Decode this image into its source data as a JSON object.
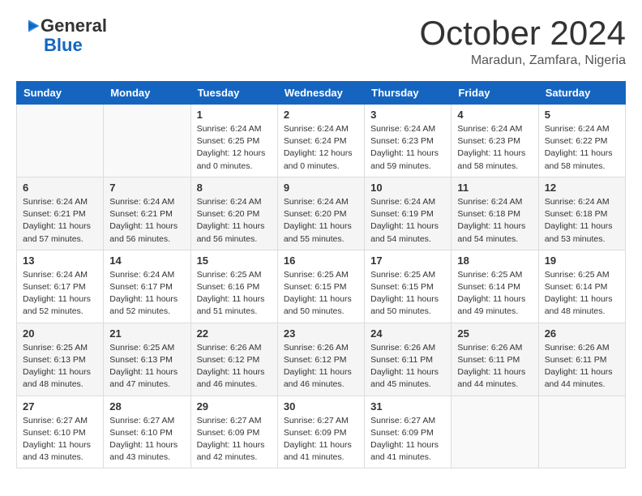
{
  "logo": {
    "line1": "General",
    "line2": "Blue"
  },
  "title": "October 2024",
  "subtitle": "Maradun, Zamfara, Nigeria",
  "days_of_week": [
    "Sunday",
    "Monday",
    "Tuesday",
    "Wednesday",
    "Thursday",
    "Friday",
    "Saturday"
  ],
  "weeks": [
    [
      {
        "day": "",
        "info": ""
      },
      {
        "day": "",
        "info": ""
      },
      {
        "day": "1",
        "info": "Sunrise: 6:24 AM\nSunset: 6:25 PM\nDaylight: 12 hours and 0 minutes."
      },
      {
        "day": "2",
        "info": "Sunrise: 6:24 AM\nSunset: 6:24 PM\nDaylight: 12 hours and 0 minutes."
      },
      {
        "day": "3",
        "info": "Sunrise: 6:24 AM\nSunset: 6:23 PM\nDaylight: 11 hours and 59 minutes."
      },
      {
        "day": "4",
        "info": "Sunrise: 6:24 AM\nSunset: 6:23 PM\nDaylight: 11 hours and 58 minutes."
      },
      {
        "day": "5",
        "info": "Sunrise: 6:24 AM\nSunset: 6:22 PM\nDaylight: 11 hours and 58 minutes."
      }
    ],
    [
      {
        "day": "6",
        "info": "Sunrise: 6:24 AM\nSunset: 6:21 PM\nDaylight: 11 hours and 57 minutes."
      },
      {
        "day": "7",
        "info": "Sunrise: 6:24 AM\nSunset: 6:21 PM\nDaylight: 11 hours and 56 minutes."
      },
      {
        "day": "8",
        "info": "Sunrise: 6:24 AM\nSunset: 6:20 PM\nDaylight: 11 hours and 56 minutes."
      },
      {
        "day": "9",
        "info": "Sunrise: 6:24 AM\nSunset: 6:20 PM\nDaylight: 11 hours and 55 minutes."
      },
      {
        "day": "10",
        "info": "Sunrise: 6:24 AM\nSunset: 6:19 PM\nDaylight: 11 hours and 54 minutes."
      },
      {
        "day": "11",
        "info": "Sunrise: 6:24 AM\nSunset: 6:18 PM\nDaylight: 11 hours and 54 minutes."
      },
      {
        "day": "12",
        "info": "Sunrise: 6:24 AM\nSunset: 6:18 PM\nDaylight: 11 hours and 53 minutes."
      }
    ],
    [
      {
        "day": "13",
        "info": "Sunrise: 6:24 AM\nSunset: 6:17 PM\nDaylight: 11 hours and 52 minutes."
      },
      {
        "day": "14",
        "info": "Sunrise: 6:24 AM\nSunset: 6:17 PM\nDaylight: 11 hours and 52 minutes."
      },
      {
        "day": "15",
        "info": "Sunrise: 6:25 AM\nSunset: 6:16 PM\nDaylight: 11 hours and 51 minutes."
      },
      {
        "day": "16",
        "info": "Sunrise: 6:25 AM\nSunset: 6:15 PM\nDaylight: 11 hours and 50 minutes."
      },
      {
        "day": "17",
        "info": "Sunrise: 6:25 AM\nSunset: 6:15 PM\nDaylight: 11 hours and 50 minutes."
      },
      {
        "day": "18",
        "info": "Sunrise: 6:25 AM\nSunset: 6:14 PM\nDaylight: 11 hours and 49 minutes."
      },
      {
        "day": "19",
        "info": "Sunrise: 6:25 AM\nSunset: 6:14 PM\nDaylight: 11 hours and 48 minutes."
      }
    ],
    [
      {
        "day": "20",
        "info": "Sunrise: 6:25 AM\nSunset: 6:13 PM\nDaylight: 11 hours and 48 minutes."
      },
      {
        "day": "21",
        "info": "Sunrise: 6:25 AM\nSunset: 6:13 PM\nDaylight: 11 hours and 47 minutes."
      },
      {
        "day": "22",
        "info": "Sunrise: 6:26 AM\nSunset: 6:12 PM\nDaylight: 11 hours and 46 minutes."
      },
      {
        "day": "23",
        "info": "Sunrise: 6:26 AM\nSunset: 6:12 PM\nDaylight: 11 hours and 46 minutes."
      },
      {
        "day": "24",
        "info": "Sunrise: 6:26 AM\nSunset: 6:11 PM\nDaylight: 11 hours and 45 minutes."
      },
      {
        "day": "25",
        "info": "Sunrise: 6:26 AM\nSunset: 6:11 PM\nDaylight: 11 hours and 44 minutes."
      },
      {
        "day": "26",
        "info": "Sunrise: 6:26 AM\nSunset: 6:11 PM\nDaylight: 11 hours and 44 minutes."
      }
    ],
    [
      {
        "day": "27",
        "info": "Sunrise: 6:27 AM\nSunset: 6:10 PM\nDaylight: 11 hours and 43 minutes."
      },
      {
        "day": "28",
        "info": "Sunrise: 6:27 AM\nSunset: 6:10 PM\nDaylight: 11 hours and 43 minutes."
      },
      {
        "day": "29",
        "info": "Sunrise: 6:27 AM\nSunset: 6:09 PM\nDaylight: 11 hours and 42 minutes."
      },
      {
        "day": "30",
        "info": "Sunrise: 6:27 AM\nSunset: 6:09 PM\nDaylight: 11 hours and 41 minutes."
      },
      {
        "day": "31",
        "info": "Sunrise: 6:27 AM\nSunset: 6:09 PM\nDaylight: 11 hours and 41 minutes."
      },
      {
        "day": "",
        "info": ""
      },
      {
        "day": "",
        "info": ""
      }
    ]
  ]
}
